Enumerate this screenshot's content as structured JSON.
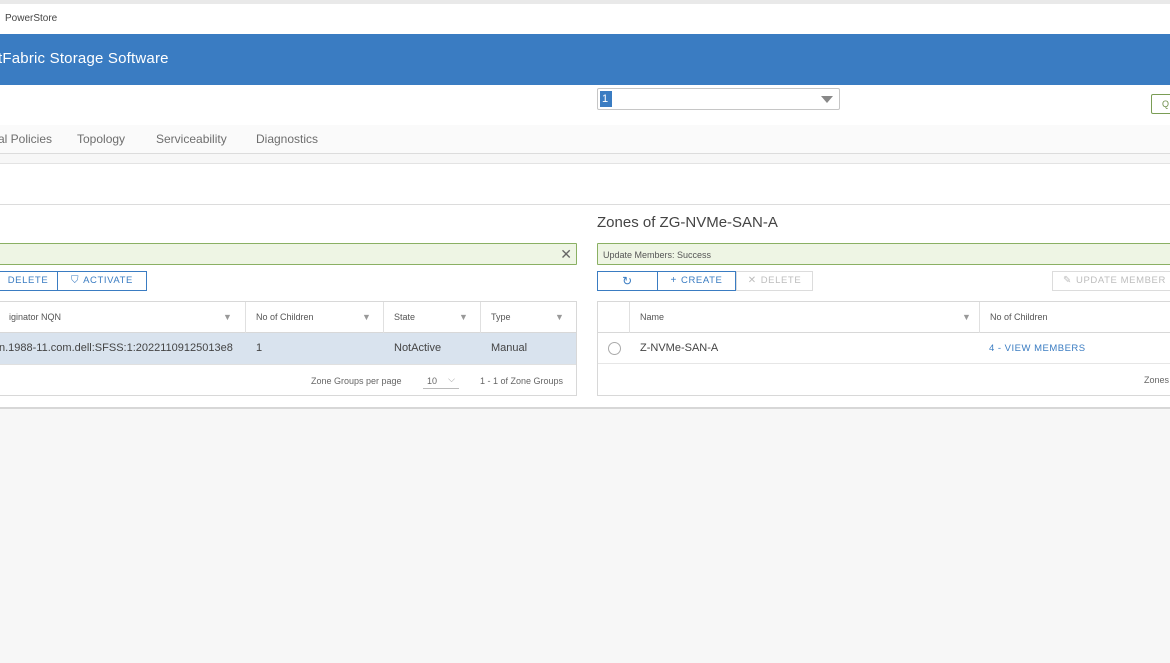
{
  "browser": {
    "tab_title": "PowerStore"
  },
  "header": {
    "title": "tFabric Storage Software"
  },
  "selector": {
    "value": "1"
  },
  "top_right_button": {
    "label": "Q"
  },
  "nav": {
    "tabs": [
      {
        "label": "al Policies"
      },
      {
        "label": "Topology"
      },
      {
        "label": "Serviceability"
      },
      {
        "label": "Diagnostics"
      }
    ]
  },
  "left": {
    "alert": {
      "text": "",
      "close": "✕"
    },
    "buttons": {
      "delete": "DELETE",
      "activate": "ACTIVATE"
    },
    "columns": [
      "iginator NQN",
      "No of Children",
      "State",
      "Type"
    ],
    "rows": [
      {
        "nqn": "n.1988-11.com.dell:SFSS:1:20221109125013e8",
        "children": "1",
        "state": "NotActive",
        "type": "Manual"
      }
    ],
    "footer": {
      "per_page_label": "Zone Groups per page",
      "per_page_value": "10",
      "range": "1 - 1 of Zone Groups"
    }
  },
  "right": {
    "title": "Zones of ZG-NVMe-SAN-A",
    "alert": {
      "text": "Update Members: Success"
    },
    "buttons": {
      "refresh": "↻",
      "create": "CREATE",
      "delete": "DELETE",
      "update_members": "UPDATE MEMBER"
    },
    "columns": [
      "Name",
      "No of Children"
    ],
    "rows": [
      {
        "name": "Z-NVMe-SAN-A",
        "children_prefix": "4 -",
        "view_members": "VIEW MEMBERS"
      }
    ],
    "footer": {
      "text": "Zones"
    }
  },
  "colors": {
    "brand": "#3a7cc2",
    "success_border": "#8ab063",
    "success_bg": "#eef5e4"
  }
}
